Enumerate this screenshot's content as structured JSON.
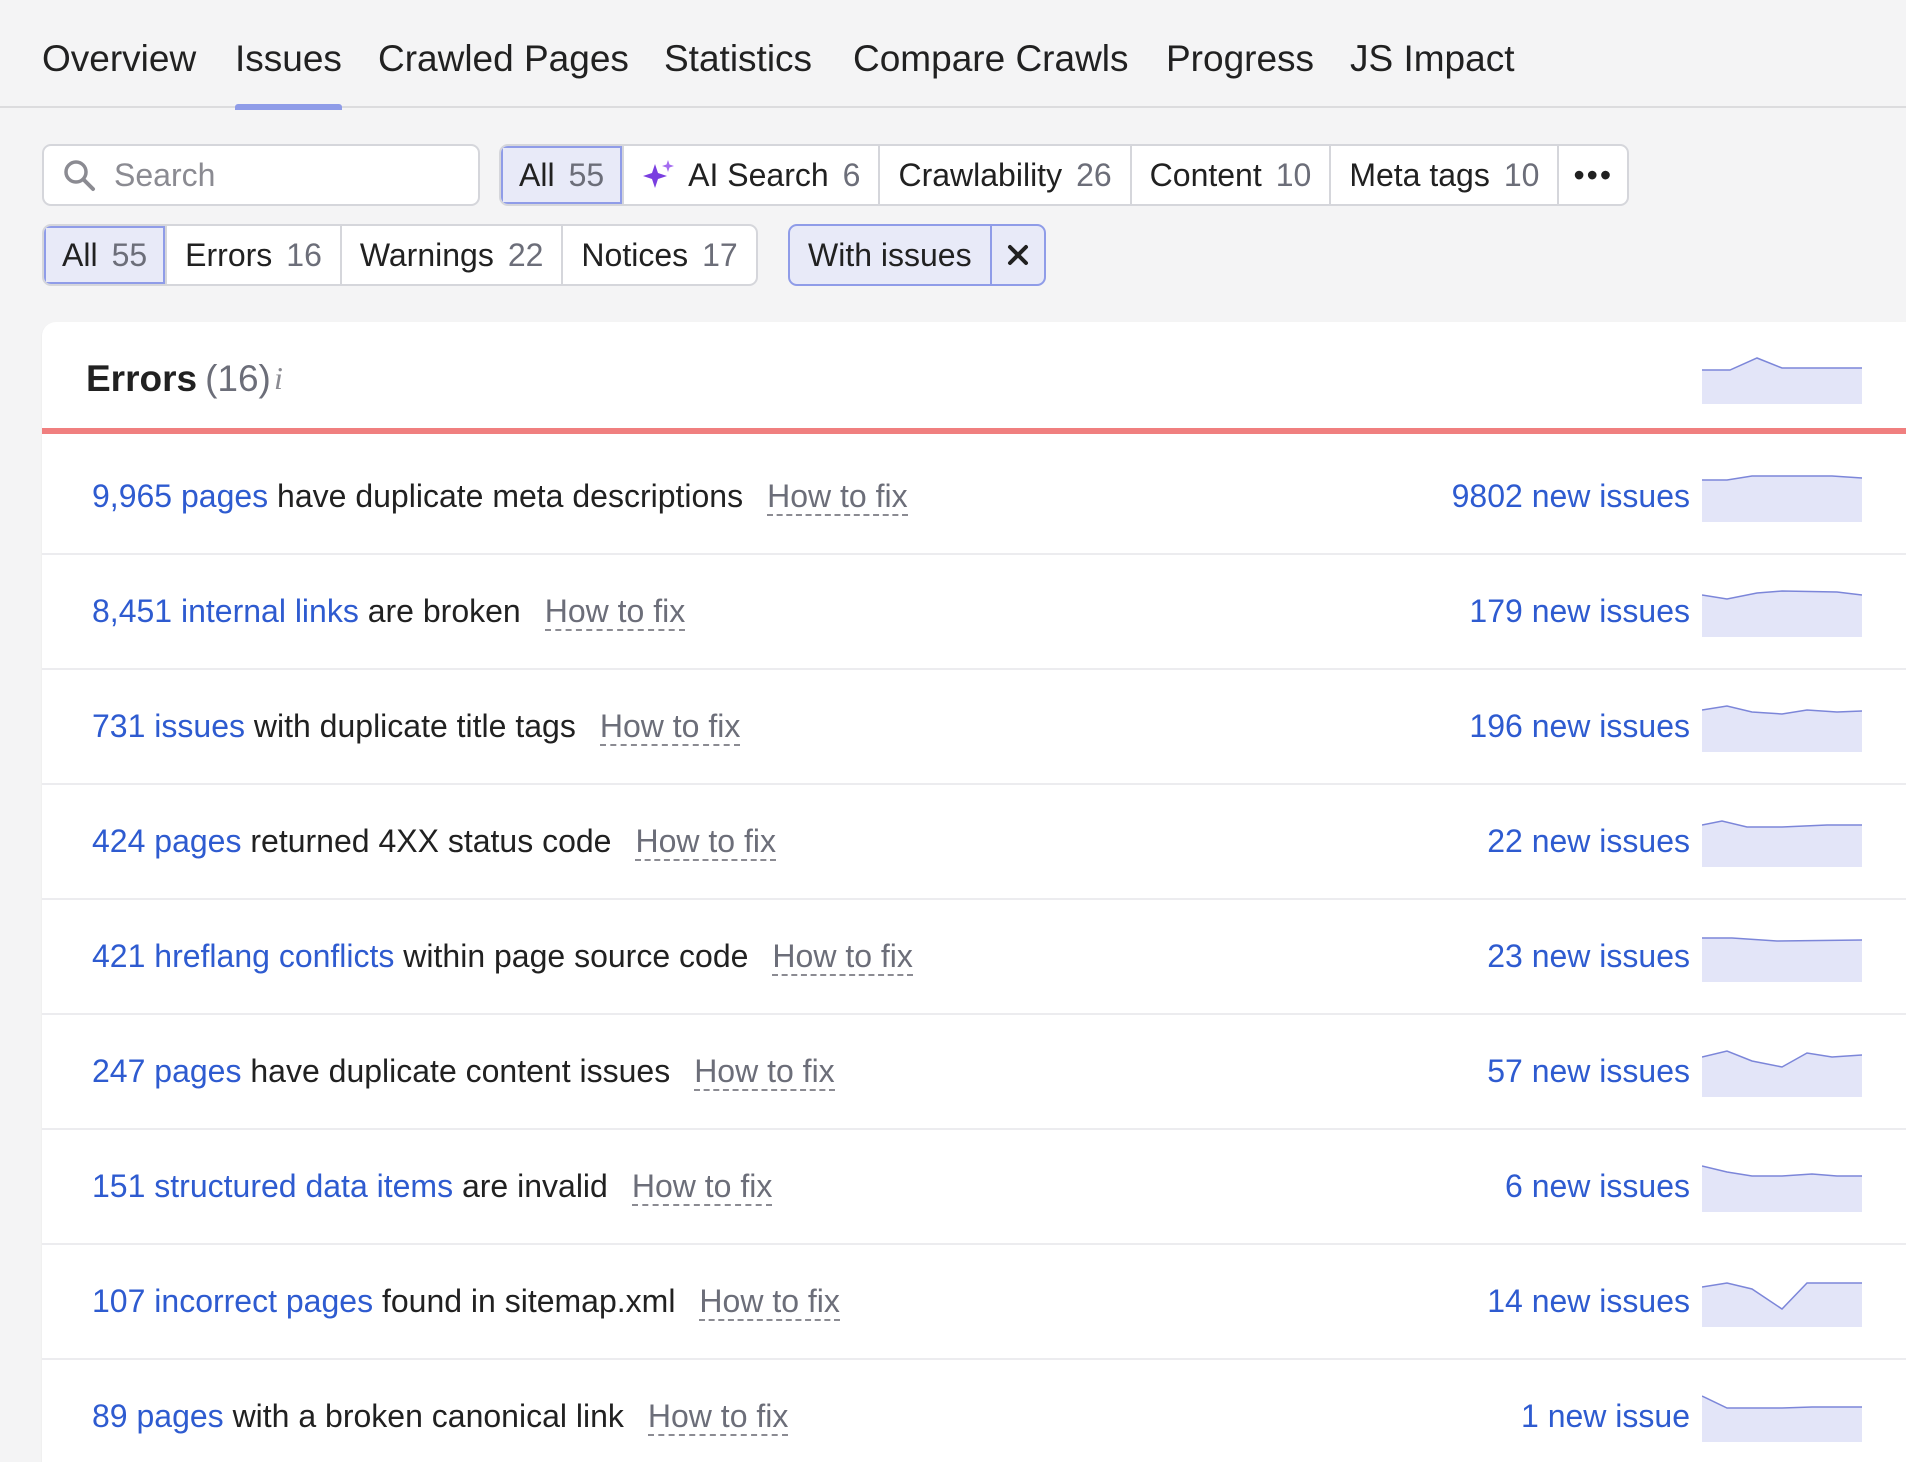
{
  "tabs": [
    "Overview",
    "Issues",
    "Crawled Pages",
    "Statistics",
    "Compare Crawls",
    "Progress",
    "JS Impact"
  ],
  "active_tab": "Issues",
  "search": {
    "placeholder": "Search",
    "icon": "search-icon"
  },
  "category_filters": [
    {
      "label": "All",
      "count": "55",
      "selected": true
    },
    {
      "label": "AI Search",
      "count": "6",
      "icon": "sparkle-icon"
    },
    {
      "label": "Crawlability",
      "count": "26"
    },
    {
      "label": "Content",
      "count": "10"
    },
    {
      "label": "Meta tags",
      "count": "10"
    },
    {
      "label": "•••",
      "icon": "more-icon"
    }
  ],
  "severity_filters": [
    {
      "label": "All",
      "count": "55",
      "selected": true
    },
    {
      "label": "Errors",
      "count": "16"
    },
    {
      "label": "Warnings",
      "count": "22"
    },
    {
      "label": "Notices",
      "count": "17"
    }
  ],
  "chip": {
    "label": "With issues",
    "close_icon": "close-icon"
  },
  "panel": {
    "title": "Errors",
    "count": "(16)",
    "info_icon": "i",
    "accent_color": "#f07f7f"
  },
  "issues": [
    {
      "link": "9,965 pages",
      "text": "have duplicate meta descriptions",
      "fix": "How to fix",
      "new_issues": "9802 new issues"
    },
    {
      "link": "8,451 internal links",
      "text": "are broken",
      "fix": "How to fix",
      "new_issues": "179 new issues"
    },
    {
      "link": "731 issues",
      "text": "with duplicate title tags",
      "fix": "How to fix",
      "new_issues": "196 new issues"
    },
    {
      "link": "424 pages",
      "text": "returned 4XX status code",
      "fix": "How to fix",
      "new_issues": "22 new issues"
    },
    {
      "link": "421 hreflang conflicts",
      "text": "within page source code",
      "fix": "How to fix",
      "new_issues": "23 new issues"
    },
    {
      "link": "247 pages",
      "text": "have duplicate content issues",
      "fix": "How to fix",
      "new_issues": "57 new issues"
    },
    {
      "link": "151 structured data items",
      "text": "are invalid",
      "fix": "How to fix",
      "new_issues": "6 new issues"
    },
    {
      "link": "107 incorrect pages",
      "text": "found in sitemap.xml",
      "fix": "How to fix",
      "new_issues": "14 new issues"
    },
    {
      "link": "89 pages",
      "text": "with a broken canonical link",
      "fix": "How to fix",
      "new_issues": "1 new issue"
    }
  ],
  "colors": {
    "link": "#2e5bd0",
    "tab_underline": "#8f9ce8",
    "sparkline_fill": "#e3e5f8",
    "sparkline_stroke": "#7c86d9"
  }
}
